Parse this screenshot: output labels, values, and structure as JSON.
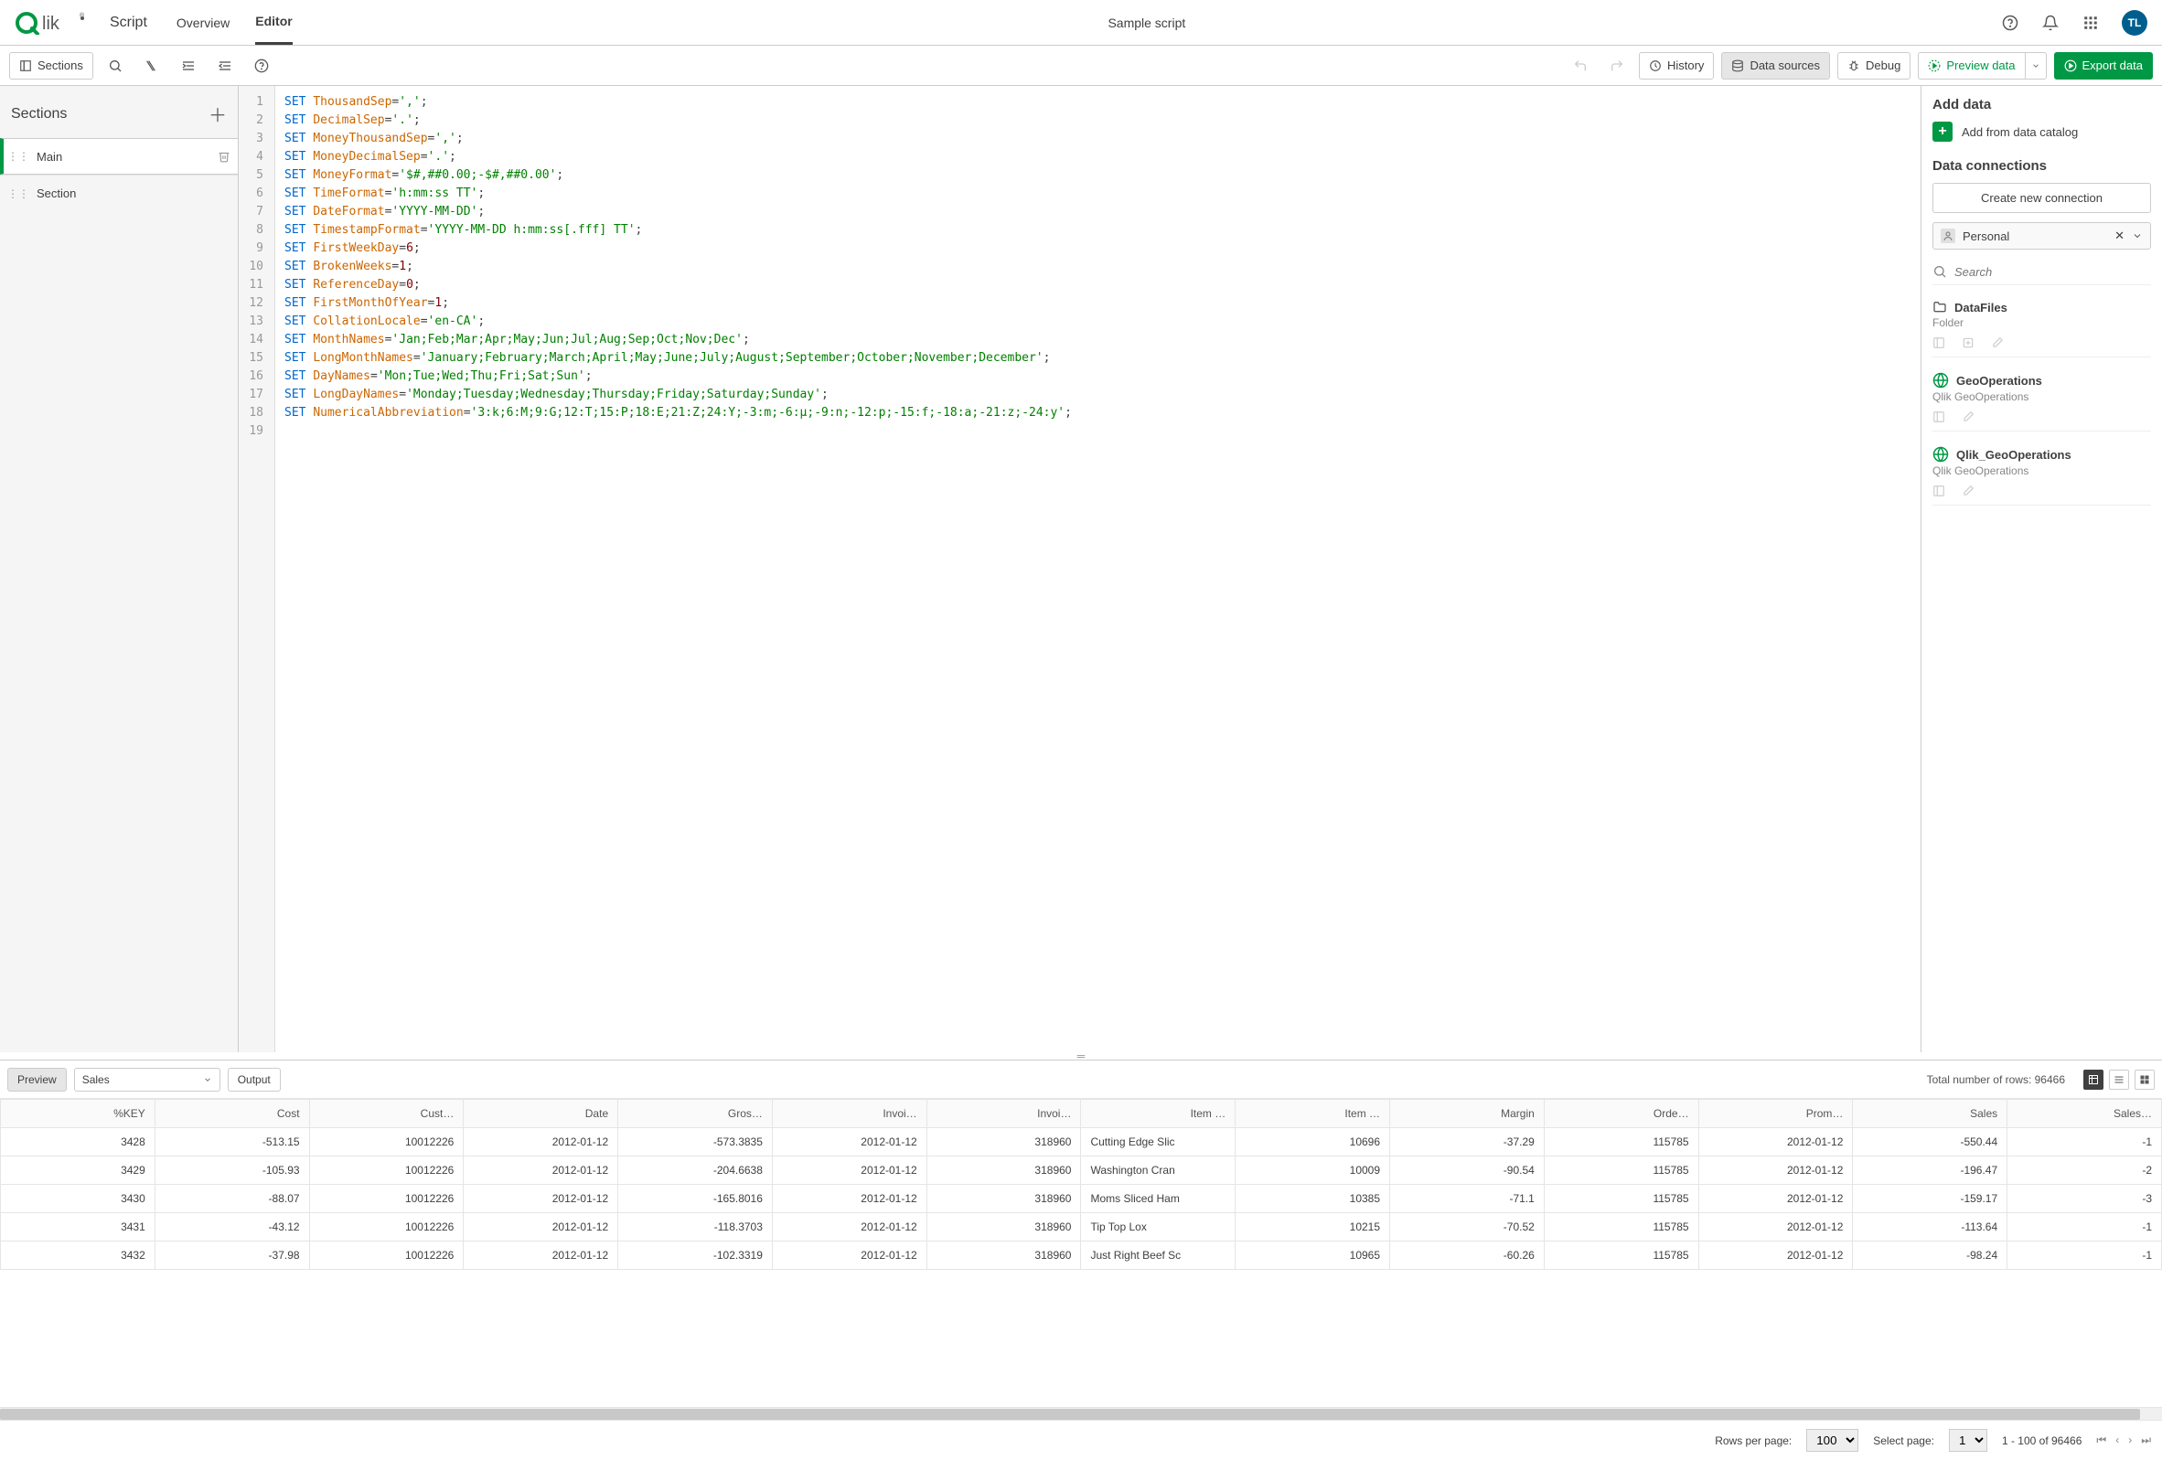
{
  "header": {
    "script_label": "Script",
    "tabs": {
      "overview": "Overview",
      "editor": "Editor"
    },
    "document_title": "Sample script",
    "avatar": "TL"
  },
  "toolbar": {
    "sections": "Sections",
    "history": "History",
    "data_sources": "Data sources",
    "debug": "Debug",
    "preview_data": "Preview data",
    "export_data": "Export data"
  },
  "sidebar": {
    "title": "Sections",
    "items": [
      {
        "label": "Main"
      },
      {
        "label": "Section"
      }
    ]
  },
  "editor": {
    "lines": [
      {
        "kw": "SET",
        "var": "ThousandSep",
        "rest": "=',';",
        "str": "','"
      },
      {
        "kw": "SET",
        "var": "DecimalSep",
        "rest": "='.';",
        "str": "'.'"
      },
      {
        "kw": "SET",
        "var": "MoneyThousandSep",
        "rest": "=',';",
        "str": "','"
      },
      {
        "kw": "SET",
        "var": "MoneyDecimalSep",
        "rest": "='.';",
        "str": "'.'"
      },
      {
        "kw": "SET",
        "var": "MoneyFormat",
        "rest": "='$#,##0.00;-$#,##0.00';",
        "str": "'$#,##0.00;-$#,##0.00'"
      },
      {
        "kw": "SET",
        "var": "TimeFormat",
        "rest": "='h:mm:ss TT';",
        "str": "'h:mm:ss TT'"
      },
      {
        "kw": "SET",
        "var": "DateFormat",
        "rest": "='YYYY-MM-DD';",
        "str": "'YYYY-MM-DD'"
      },
      {
        "kw": "SET",
        "var": "TimestampFormat",
        "rest": "='YYYY-MM-DD h:mm:ss[.fff] TT';",
        "str": "'YYYY-MM-DD h:mm:ss[.fff] TT'"
      },
      {
        "kw": "SET",
        "var": "FirstWeekDay",
        "rest": "=6;",
        "num": "6"
      },
      {
        "kw": "SET",
        "var": "BrokenWeeks",
        "rest": "=1;",
        "num": "1"
      },
      {
        "kw": "SET",
        "var": "ReferenceDay",
        "rest": "=0;",
        "num": "0"
      },
      {
        "kw": "SET",
        "var": "FirstMonthOfYear",
        "rest": "=1;",
        "num": "1"
      },
      {
        "kw": "SET",
        "var": "CollationLocale",
        "rest": "='en-CA';",
        "str": "'en-CA'"
      },
      {
        "kw": "SET",
        "var": "MonthNames",
        "rest": "='Jan;Feb;Mar;Apr;May;Jun;Jul;Aug;Sep;Oct;Nov;Dec';",
        "str": "'Jan;Feb;Mar;Apr;May;Jun;Jul;Aug;Sep;Oct;Nov;Dec'"
      },
      {
        "kw": "SET",
        "var": "LongMonthNames",
        "rest": "='January;February;March;April;May;June;July;August;September;October;November;December';",
        "str": "'January;February;March;April;May;June;July;August;September;October;November;December'"
      },
      {
        "kw": "SET",
        "var": "DayNames",
        "rest": "='Mon;Tue;Wed;Thu;Fri;Sat;Sun';",
        "str": "'Mon;Tue;Wed;Thu;Fri;Sat;Sun'"
      },
      {
        "kw": "SET",
        "var": "LongDayNames",
        "rest": "='Monday;Tuesday;Wednesday;Thursday;Friday;Saturday;Sunday';",
        "str": "'Monday;Tuesday;Wednesday;Thursday;Friday;Saturday;Sunday'"
      },
      {
        "kw": "SET",
        "var": "NumericalAbbreviation",
        "rest": "='3:k;6:M;9:G;12:T;15:P;18:E;21:Z;24:Y;-3:m;-6:μ;-9:n;-12:p;-15:f;-18:a;-21:z;-24:y';",
        "str": "'3:k;6:M;9:G;12:T;15:P;18:E;21:Z;24:Y;-3:m;-6:μ;-9:n;-12:p;-15:f;-18:a;-21:z;-24:y'"
      }
    ],
    "line_count": 19
  },
  "right": {
    "add_data": "Add data",
    "add_catalog": "Add from data catalog",
    "data_connections": "Data connections",
    "create_connection": "Create new connection",
    "space": "Personal",
    "search_placeholder": "Search",
    "connections": [
      {
        "name": "DataFiles",
        "sub": "Folder",
        "icon": "folder"
      },
      {
        "name": "GeoOperations",
        "sub": "Qlik GeoOperations",
        "icon": "globe"
      },
      {
        "name": "Qlik_GeoOperations",
        "sub": "Qlik GeoOperations",
        "icon": "globe"
      }
    ]
  },
  "preview": {
    "preview_label": "Preview",
    "table_select": "Sales",
    "output_label": "Output",
    "total_label": "Total number of rows: 96466",
    "columns": [
      "%KEY",
      "Cost",
      "Cust…",
      "Date",
      "Gros…",
      "Invoi…",
      "Invoi…",
      "Item …",
      "Item …",
      "Margin",
      "Orde…",
      "Prom…",
      "Sales",
      "Sales…"
    ],
    "rows": [
      [
        "3428",
        "-513.15",
        "10012226",
        "2012-01-12",
        "-573.3835",
        "2012-01-12",
        "318960",
        "Cutting Edge Slic",
        "10696",
        "-37.29",
        "115785",
        "2012-01-12",
        "-550.44",
        "-1"
      ],
      [
        "3429",
        "-105.93",
        "10012226",
        "2012-01-12",
        "-204.6638",
        "2012-01-12",
        "318960",
        "Washington Cran",
        "10009",
        "-90.54",
        "115785",
        "2012-01-12",
        "-196.47",
        "-2"
      ],
      [
        "3430",
        "-88.07",
        "10012226",
        "2012-01-12",
        "-165.8016",
        "2012-01-12",
        "318960",
        "Moms Sliced Ham",
        "10385",
        "-71.1",
        "115785",
        "2012-01-12",
        "-159.17",
        "-3"
      ],
      [
        "3431",
        "-43.12",
        "10012226",
        "2012-01-12",
        "-118.3703",
        "2012-01-12",
        "318960",
        "Tip Top Lox",
        "10215",
        "-70.52",
        "115785",
        "2012-01-12",
        "-113.64",
        "-1"
      ],
      [
        "3432",
        "-37.98",
        "10012226",
        "2012-01-12",
        "-102.3319",
        "2012-01-12",
        "318960",
        "Just Right Beef Sc",
        "10965",
        "-60.26",
        "115785",
        "2012-01-12",
        "-98.24",
        "-1"
      ]
    ],
    "rows_per_page_label": "Rows per page:",
    "rows_per_page": "100",
    "select_page_label": "Select page:",
    "select_page": "1",
    "range": "1 - 100 of 96466"
  }
}
